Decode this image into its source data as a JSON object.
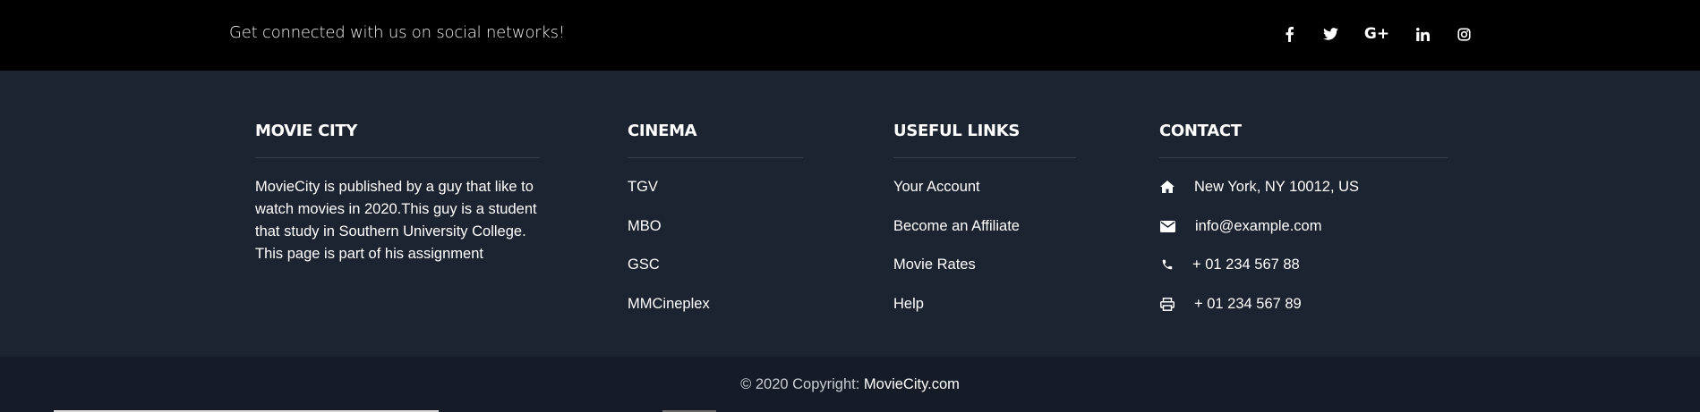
{
  "social": {
    "tagline": "Get connected with us on social networks!",
    "icons": [
      "facebook-icon",
      "twitter-icon",
      "google-plus-icon",
      "linkedin-icon",
      "instagram-icon"
    ],
    "google_label": "G+"
  },
  "about": {
    "title": "MOVIE CITY",
    "text": "MovieCity is published by a guy that like to watch movies in 2020.This guy is a student that study in Southern University College. This page is part of his assignment"
  },
  "cinema": {
    "title": "CINEMA",
    "links": [
      "TGV",
      "MBO",
      "GSC",
      "MMCineplex"
    ]
  },
  "useful": {
    "title": "USEFUL LINKS",
    "links": [
      "Your Account",
      "Become an Affiliate",
      "Movie Rates",
      "Help"
    ]
  },
  "contact": {
    "title": "CONTACT",
    "address": "New York, NY 10012, US",
    "email": "info@example.com",
    "phone": "+ 01 234 567 88",
    "fax": "+ 01 234 567 89"
  },
  "footer": {
    "copyright_prefix": "© 2020 Copyright: ",
    "brand": "MovieCity.com"
  },
  "colors": {
    "top_bar": "#000000",
    "main_bg": "#1c2331",
    "bottom_bar": "#161c27",
    "text": "#ffffff"
  }
}
